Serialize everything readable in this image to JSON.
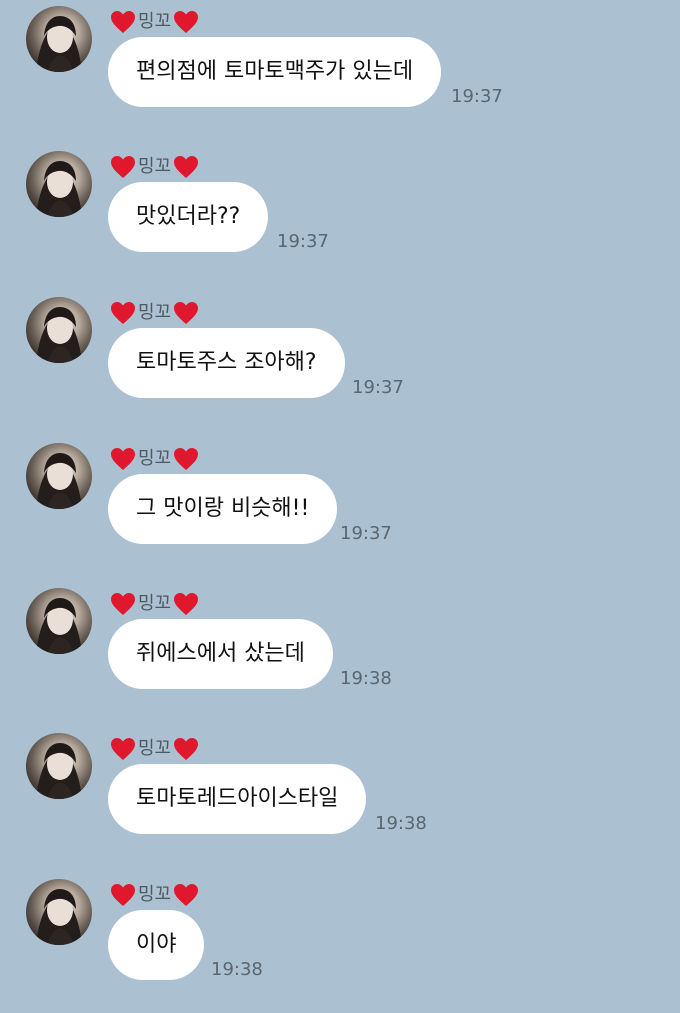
{
  "sender": {
    "name": "밍꼬",
    "decoration": "red-heart-icon"
  },
  "messages": [
    {
      "text": "편의점에 토마토맥주가 있는데",
      "time": "19:37"
    },
    {
      "text": "맛있더라??",
      "time": "19:37"
    },
    {
      "text": "토마토주스 조아해?",
      "time": "19:37"
    },
    {
      "text": "그 맛이랑 비슷해!!",
      "time": "19:37"
    },
    {
      "text": "쥐에스에서 샀는데",
      "time": "19:38"
    },
    {
      "text": "토마토레드아이스타일",
      "time": "19:38"
    },
    {
      "text": "이야",
      "time": "19:38"
    }
  ],
  "colors": {
    "background": "#abc1d1",
    "bubble": "#ffffff",
    "heart": "#e0182d"
  }
}
